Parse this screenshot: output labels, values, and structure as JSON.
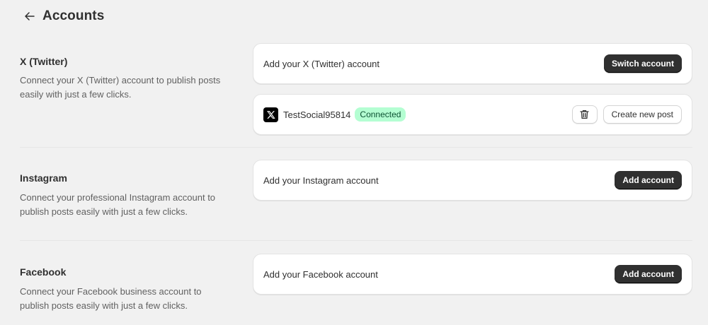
{
  "header": {
    "back_icon": "arrow-left-icon",
    "title": "Accounts"
  },
  "sections": {
    "twitter": {
      "title": "X (Twitter)",
      "description": "Connect your X (Twitter) account to publish posts easily with just a few clicks.",
      "card_text": "Add your X (Twitter) account",
      "button_label": "Switch account",
      "connected_account": {
        "logo_icon": "x-logo-icon",
        "username": "TestSocial95814",
        "status": "Connected",
        "delete_icon": "trash-icon",
        "create_post_label": "Create new post"
      }
    },
    "instagram": {
      "title": "Instagram",
      "description": "Connect your professional Instagram account to publish posts easily with just a few clicks.",
      "card_text": "Add your Instagram account",
      "button_label": "Add account"
    },
    "facebook": {
      "title": "Facebook",
      "description": "Connect your Facebook business account to publish posts easily with just a few clicks.",
      "card_text": "Add your Facebook account",
      "button_label": "Add account"
    }
  },
  "colors": {
    "background": "#f1f1f1",
    "card": "#ffffff",
    "primary_button": "#303030",
    "connected_badge_bg": "#b4fed2",
    "connected_badge_text": "#0c5132"
  }
}
